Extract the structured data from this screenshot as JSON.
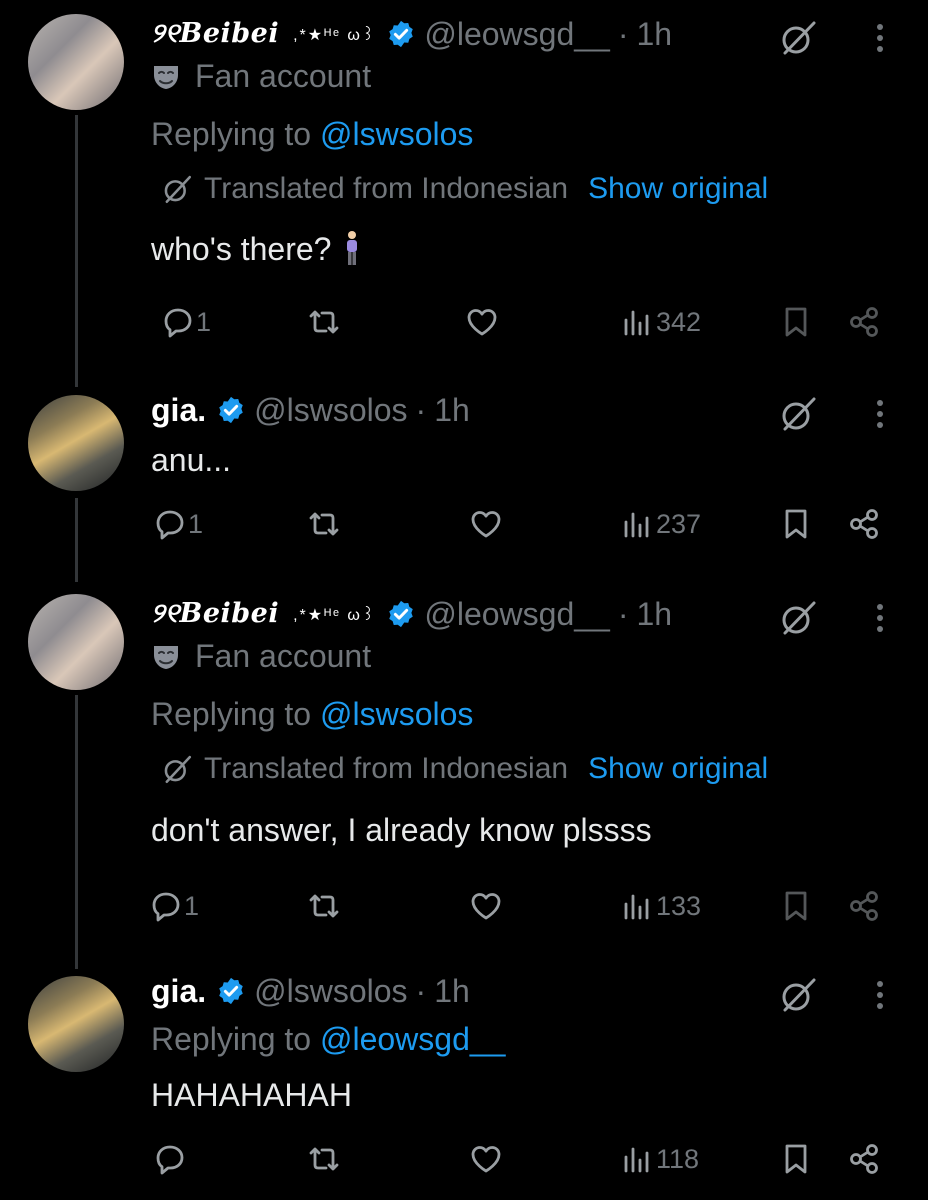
{
  "posts": [
    {
      "display_name": "୨୧Beibei",
      "name_deco": ",*★ᴴᵉ ω꒱",
      "handle": "@leowsgd__",
      "dot": "·",
      "time": "1h",
      "badge": "Fan account",
      "replying_prefix": "Replying to ",
      "replying_to": "@lswsolos",
      "translated_label": "Translated from Indonesian",
      "show_original": "Show original",
      "text": "who's there?",
      "stats": {
        "replies": "1",
        "views": "342"
      }
    },
    {
      "display_name": "gia.",
      "handle": "@lswsolos",
      "dot": "·",
      "time": "1h",
      "text": "anu...",
      "stats": {
        "replies": "1",
        "views": "237"
      }
    },
    {
      "display_name": "୨୧Beibei",
      "name_deco": ",*★ᴴᵉ ω꒱",
      "handle": "@leowsgd__",
      "dot": "·",
      "time": "1h",
      "badge": "Fan account",
      "replying_prefix": "Replying to ",
      "replying_to": "@lswsolos",
      "translated_label": "Translated from Indonesian",
      "show_original": "Show original",
      "text": "don't answer, I already know plssss",
      "stats": {
        "replies": "1",
        "views": "133"
      }
    },
    {
      "display_name": "gia.",
      "handle": "@lswsolos",
      "dot": "·",
      "time": "1h",
      "replying_prefix": "Replying to ",
      "replying_to": "@leowsgd__",
      "text": "HAHAHAHAH",
      "stats": {
        "replies": "",
        "views": "118"
      }
    }
  ],
  "colors": {
    "background": "#000000",
    "text": "#e7e9ea",
    "secondary": "#71767b",
    "link": "#1d9bf0",
    "verified": "#1d9bf0"
  },
  "icons": [
    "verified-badge-icon",
    "grok-icon",
    "more-icon",
    "mask-icon",
    "translate-icon",
    "person-emoji-icon",
    "reply-icon",
    "repost-icon",
    "like-icon",
    "views-icon",
    "bookmark-icon",
    "share-icon"
  ]
}
